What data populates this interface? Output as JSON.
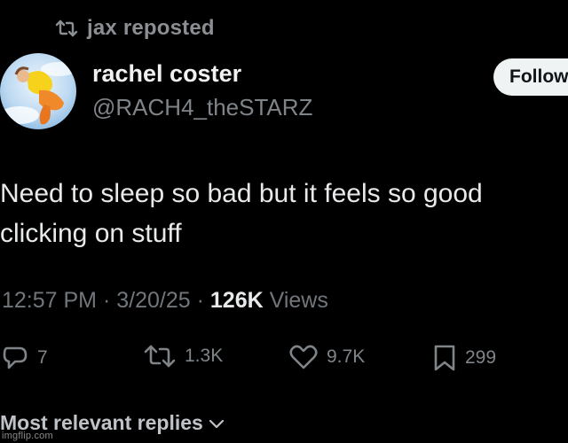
{
  "repost": {
    "text": "jax reposted",
    "icon": "repost-icon"
  },
  "author": {
    "name": "rachel coster",
    "handle": "@RACH4_theSTARZ",
    "avatar_icon": "avatar"
  },
  "follow_button": {
    "label": "Follow"
  },
  "tweet": {
    "lines": [
      "Need to sleep so bad but it feels so good",
      "clicking on stuff"
    ]
  },
  "meta": {
    "time": "12:57 PM",
    "separator": "·",
    "date": "3/20/25",
    "views_count": "126K",
    "views_label": "Views"
  },
  "actions": {
    "replies": {
      "icon": "reply-icon",
      "count": "7"
    },
    "reposts": {
      "icon": "repost-icon",
      "count": "1.3K"
    },
    "likes": {
      "icon": "heart-icon",
      "count": "9.7K"
    },
    "bookmarks": {
      "icon": "bookmark-icon",
      "count": "299"
    }
  },
  "replies_sort": {
    "label": "Most relevant replies",
    "icon": "chevron-down-icon"
  },
  "watermark": {
    "text": "imgflip.com"
  },
  "colors": {
    "background": "#000000",
    "text_primary": "#e7e9ea",
    "text_secondary": "#71767b",
    "follow_bg": "#eff3f4"
  }
}
